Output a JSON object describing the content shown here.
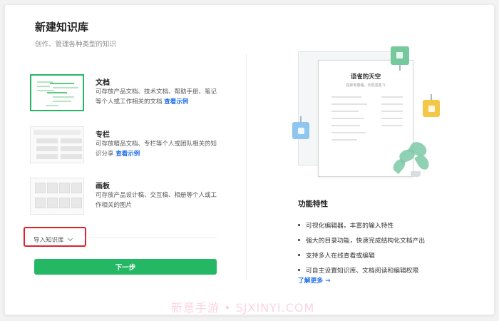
{
  "dialog": {
    "title": "新建知识库",
    "subtitle": "创作、管理各种类型的知识"
  },
  "types": [
    {
      "name": "文档",
      "desc": "可存放产品文档、技术文档、帮助手册、笔记等个人或工作相关的文档",
      "link": "查看示例",
      "selected": true
    },
    {
      "name": "专栏",
      "desc": "可存放精品文档、专栏等个人或团队相关的知识分享",
      "link": "查看示例",
      "selected": false
    },
    {
      "name": "画板",
      "desc": "可存放产品设计稿、交互稿、相册等个人或工作相关的图片",
      "link": "",
      "selected": false
    }
  ],
  "import": {
    "label": "导入知识库"
  },
  "next_button": {
    "label": "下一步"
  },
  "illustration": {
    "title": "语雀的天空",
    "subtitle": "指挥朱春路，天辰送鑫飞"
  },
  "features": {
    "title": "功能特性",
    "items": [
      "可视化编辑器，丰富的输入特性",
      "强大的目录功能，快速完成结构化文档产出",
      "支持多人在线查看或编辑",
      "可自主设置知识库、文档阅读和编辑权限"
    ],
    "learn_more": "了解更多 →"
  },
  "watermark": "新意手游 • SJXINYI.COM",
  "colors": {
    "accent": "#25b864",
    "link": "#1f6ee8",
    "highlight": "#e0202b"
  }
}
